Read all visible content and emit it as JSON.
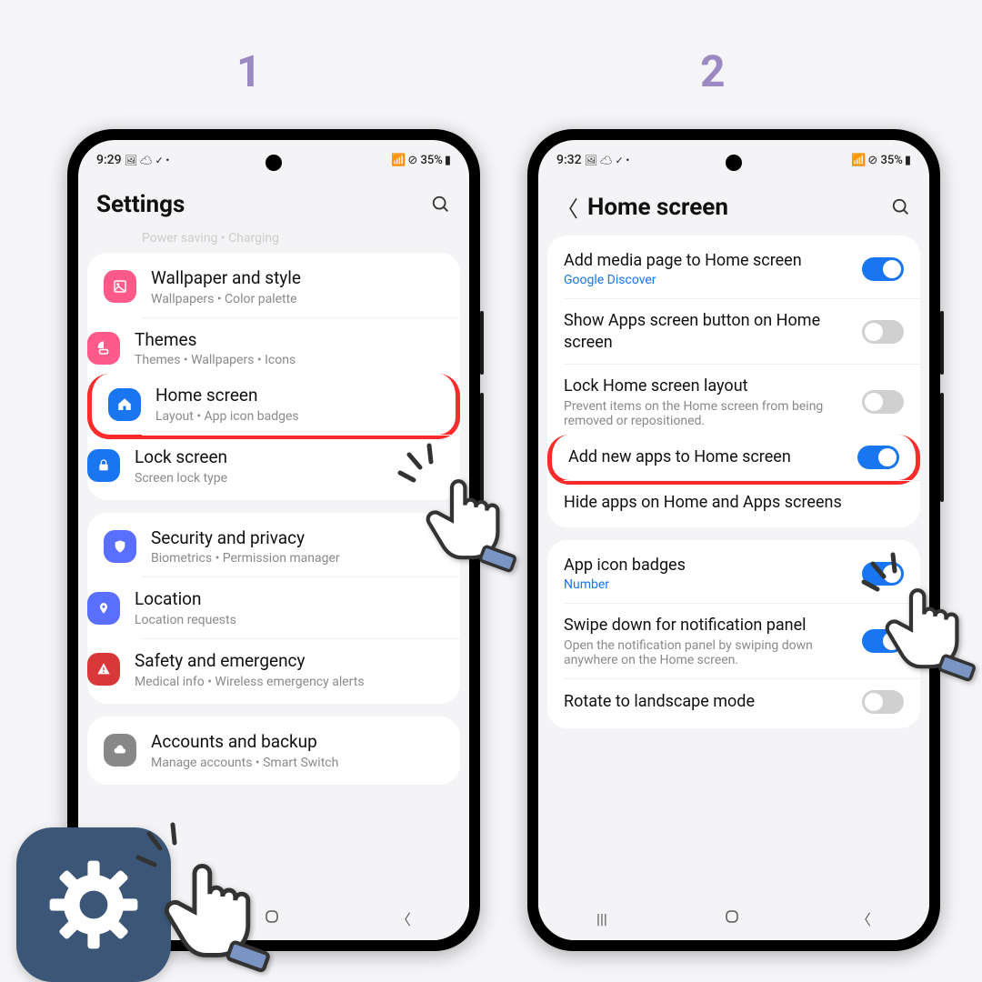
{
  "steps": {
    "one": "1",
    "two": "2"
  },
  "phone1": {
    "status": {
      "time": "9:29",
      "icons_left": "🖼 ☁ ✓ •",
      "battery": "⊘ 35%",
      "wifi": "📶"
    },
    "title": "Settings",
    "truncated": "Power saving  •  Charging",
    "rows": {
      "wallpaper": {
        "title": "Wallpaper and style",
        "sub": "Wallpapers  •  Color palette"
      },
      "themes": {
        "title": "Themes",
        "sub": "Themes  •  Wallpapers  •  Icons"
      },
      "home": {
        "title": "Home screen",
        "sub": "Layout  •  App icon badges"
      },
      "lock": {
        "title": "Lock screen",
        "sub": "Screen lock type"
      },
      "security": {
        "title": "Security and privacy",
        "sub": "Biometrics  •  Permission manager"
      },
      "location": {
        "title": "Location",
        "sub": "Location requests"
      },
      "safety": {
        "title": "Safety and emergency",
        "sub": "Medical info  •  Wireless emergency alerts"
      },
      "accounts": {
        "title": "Accounts and backup",
        "sub": "Manage accounts  •  Smart Switch"
      }
    }
  },
  "phone2": {
    "status": {
      "time": "9:32",
      "icons_left": "🖼 ☁ ✓ •",
      "battery": "⊘ 35%",
      "wifi": "📶"
    },
    "title": "Home screen",
    "rows": {
      "media": {
        "title": "Add media page to Home screen",
        "sub": "Google Discover"
      },
      "apps_btn": {
        "title": "Show Apps screen button on Home screen"
      },
      "lock_layout": {
        "title": "Lock Home screen layout",
        "sub": "Prevent items on the Home screen from being removed or repositioned."
      },
      "add_new": {
        "title": "Add new apps to Home screen"
      },
      "hide": {
        "title": "Hide apps on Home and Apps screens"
      },
      "badges": {
        "title": "App icon badges",
        "sub": "Number"
      },
      "swipe": {
        "title": "Swipe down for notification panel",
        "sub": "Open the notification panel by swiping down anywhere on the Home screen."
      },
      "rotate": {
        "title": "Rotate to landscape mode"
      }
    }
  }
}
